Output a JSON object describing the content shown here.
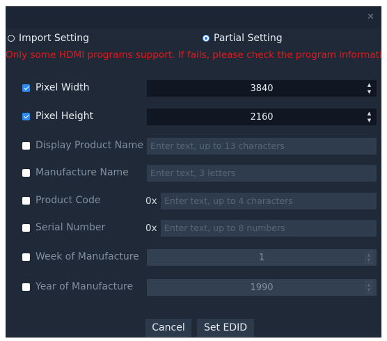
{
  "dialog": {
    "close_icon": "✕"
  },
  "mode": {
    "import_label": "Import Setting",
    "partial_label": "Partial Setting",
    "selected": "partial"
  },
  "warning": "Only some HDMI programs support. If fails, please check the program information",
  "fields": {
    "pixel_width": {
      "label": "Pixel Width",
      "checked": true,
      "value": "3840"
    },
    "pixel_height": {
      "label": "Pixel Height",
      "checked": true,
      "value": "2160"
    },
    "display_product_name": {
      "label": "Display Product Name",
      "checked": false,
      "value": "",
      "placeholder": "Enter text, up to 13 characters"
    },
    "manufacture_name": {
      "label": "Manufacture Name",
      "checked": false,
      "value": "",
      "placeholder": "Enter text, 3 letters"
    },
    "product_code": {
      "label": "Product Code",
      "checked": false,
      "prefix": "0x",
      "value": "",
      "placeholder": "Enter text, up to 4 characters"
    },
    "serial_number": {
      "label": "Serial Number",
      "checked": false,
      "prefix": "0x",
      "value": "",
      "placeholder": "Enter text, up to 8 numbers"
    },
    "week_of_manufacture": {
      "label": "Week of Manufacture",
      "checked": false,
      "value": "1"
    },
    "year_of_manufacture": {
      "label": "Year of Manufacture",
      "checked": false,
      "value": "1990"
    }
  },
  "buttons": {
    "cancel": "Cancel",
    "set_edid": "Set EDID"
  },
  "colors": {
    "dialog_bg": "#1f2937",
    "warning": "#e81818",
    "accent": "#2f8af0"
  },
  "icons": {
    "spin_up": "▲",
    "spin_down": "▼"
  }
}
